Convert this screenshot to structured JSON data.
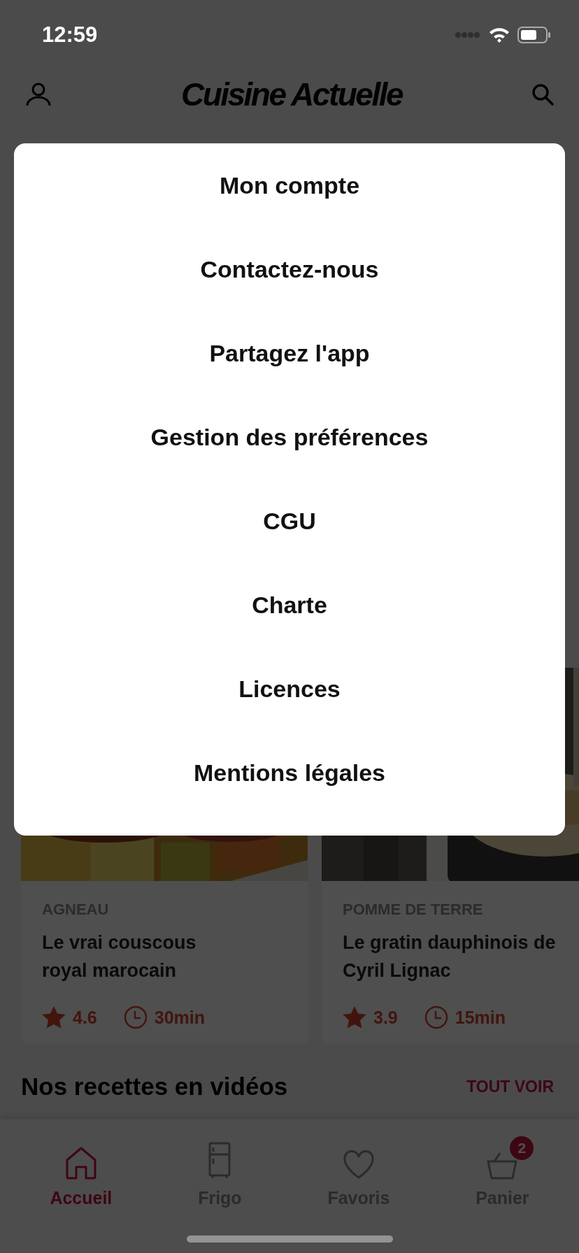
{
  "status_bar": {
    "time": "12:59"
  },
  "header": {
    "logo": "Cuisine Actuelle"
  },
  "recipes": [
    {
      "category": "AGNEAU",
      "title": "Le vrai couscous\nroyal marocain",
      "rating": "4.6",
      "duration": "30min"
    },
    {
      "category": "POMME DE TERRE",
      "title": "Le gratin dauphinois de\nCyril Lignac",
      "rating": "3.9",
      "duration": "15min"
    }
  ],
  "section": {
    "title": "Nos recettes en vidéos",
    "action": "TOUT VOIR"
  },
  "nav": [
    {
      "label": "Accueil",
      "kind": "home",
      "selected": true
    },
    {
      "label": "Frigo",
      "kind": "fridge",
      "selected": false
    },
    {
      "label": "Favoris",
      "kind": "heart",
      "selected": false
    },
    {
      "label": "Panier",
      "kind": "basket",
      "selected": false,
      "badge": "2"
    }
  ],
  "menu": [
    {
      "label": "Mon compte"
    },
    {
      "label": "Contactez-nous"
    },
    {
      "label": "Partagez l'app"
    },
    {
      "label": "Gestion des préférences"
    },
    {
      "label": "CGU"
    },
    {
      "label": "Charte"
    },
    {
      "label": "Licences"
    },
    {
      "label": "Mentions légales"
    }
  ]
}
